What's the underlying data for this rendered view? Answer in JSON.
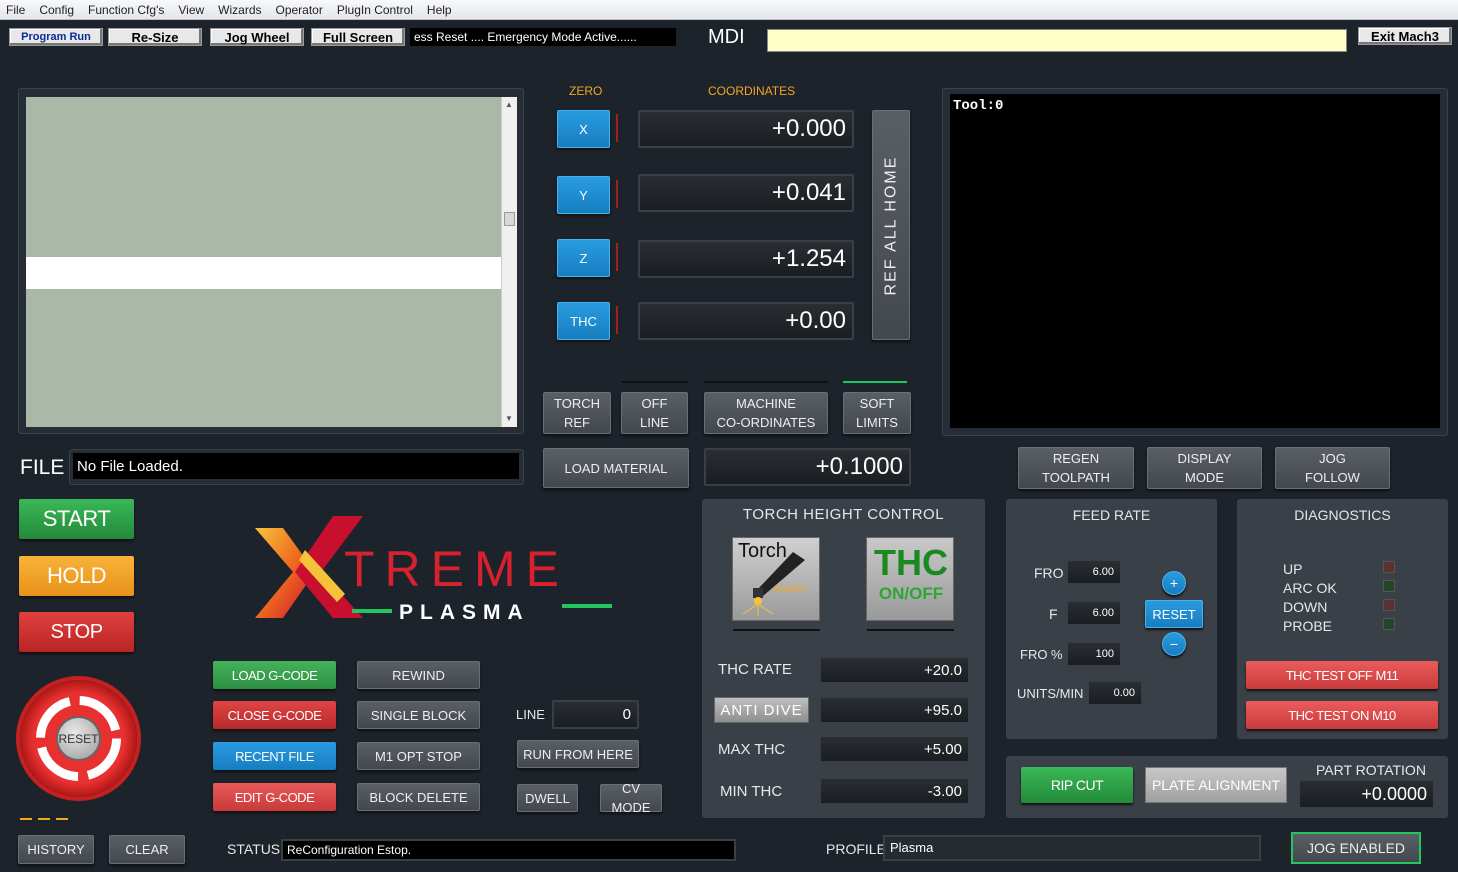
{
  "menu": [
    "File",
    "Config",
    "Function Cfg's",
    "View",
    "Wizards",
    "Operator",
    "PlugIn Control",
    "Help"
  ],
  "toolbar": {
    "program_run": "Program Run",
    "resize": "Re-Size",
    "jog_wheel": "Jog Wheel",
    "full_screen": "Full Screen",
    "status_ticker": "ess Reset .... Emergency Mode Active......",
    "mdi_label": "MDI",
    "mdi_value": "",
    "exit": "Exit Mach3"
  },
  "headers": {
    "zero": "ZERO",
    "coordinates": "COORDINATES"
  },
  "axes": [
    {
      "label": "X",
      "value": "+0.000"
    },
    {
      "label": "Y",
      "value": "+0.041"
    },
    {
      "label": "Z",
      "value": "+1.254"
    },
    {
      "label": "THC",
      "value": "+0.00"
    }
  ],
  "ref_all_home": "REF ALL HOME",
  "mode_buttons": {
    "torch_ref": "TORCH\nREF",
    "off_line": "OFF\nLINE",
    "machine_coords": "MACHINE\nCO-ORDINATES",
    "soft_limits": "SOFT\nLIMITS"
  },
  "load_material": "LOAD MATERIAL",
  "material_value": "+0.1000",
  "toolpath": {
    "tool_label": "Tool:0"
  },
  "view_buttons": {
    "regen": "REGEN\nTOOLPATH",
    "display_mode": "DISPLAY\nMODE",
    "jog_follow": "JOG\nFOLLOW"
  },
  "file": {
    "label": "FILE",
    "value": "No File Loaded."
  },
  "control": {
    "start": "START",
    "hold": "HOLD",
    "stop": "STOP",
    "reset": "RESET"
  },
  "logo": {
    "brand_top": "TREME",
    "brand_bottom": "PLASMA"
  },
  "gcode": {
    "load": "LOAD G-CODE",
    "close": "CLOSE G-CODE",
    "recent": "RECENT FILE",
    "edit": "EDIT G-CODE",
    "rewind": "REWIND",
    "single_block": "SINGLE BLOCK",
    "m1_opt_stop": "M1 OPT STOP",
    "block_delete": "BLOCK DELETE",
    "line_label": "LINE",
    "line_value": "0",
    "run_from_here": "RUN FROM HERE",
    "dwell": "DWELL",
    "cv_mode": "CV MODE"
  },
  "thc": {
    "title": "TORCH HEIGHT CONTROL",
    "torch_text": "Torch",
    "torch_sub": "ON/OFF",
    "thc_text": "THC",
    "thc_sub": "ON/OFF",
    "rate_label": "THC RATE",
    "rate_value": "+20.0",
    "anti_dive": "ANTI DIVE",
    "anti_value": "+95.0",
    "max_label": "MAX THC",
    "max_value": "+5.00",
    "min_label": "MIN THC",
    "min_value": "-3.00"
  },
  "feed": {
    "title": "FEED RATE",
    "fro_label": "FRO",
    "fro_value": "6.00",
    "f_label": "F",
    "f_value": "6.00",
    "frop_label": "FRO %",
    "frop_value": "100",
    "units_label": "UNITS/MIN",
    "units_value": "0.00",
    "plus": "+",
    "reset": "RESET",
    "minus": "−"
  },
  "diag": {
    "title": "DIAGNOSTICS",
    "up": "UP",
    "arc_ok": "ARC OK",
    "down": "DOWN",
    "probe": "PROBE",
    "test_off": "THC TEST OFF M11",
    "test_on": "THC TEST ON M10"
  },
  "bottom": {
    "rip_cut": "RIP CUT",
    "plate_alignment": "PLATE ALIGNMENT",
    "part_rotation_label": "PART ROTATION",
    "part_rotation_value": "+0.0000",
    "history": "HISTORY",
    "clear": "CLEAR",
    "status_label": "STATUS",
    "status_value": "ReConfiguration Estop.",
    "profile_label": "PROFILE",
    "profile_value": "Plasma",
    "jog_enabled": "JOG ENABLED"
  },
  "colors": {
    "green": "#2fa84a",
    "orange": "#f5a623",
    "red": "#d83333",
    "blue": "#1e90d8",
    "bg": "#1d232b"
  }
}
